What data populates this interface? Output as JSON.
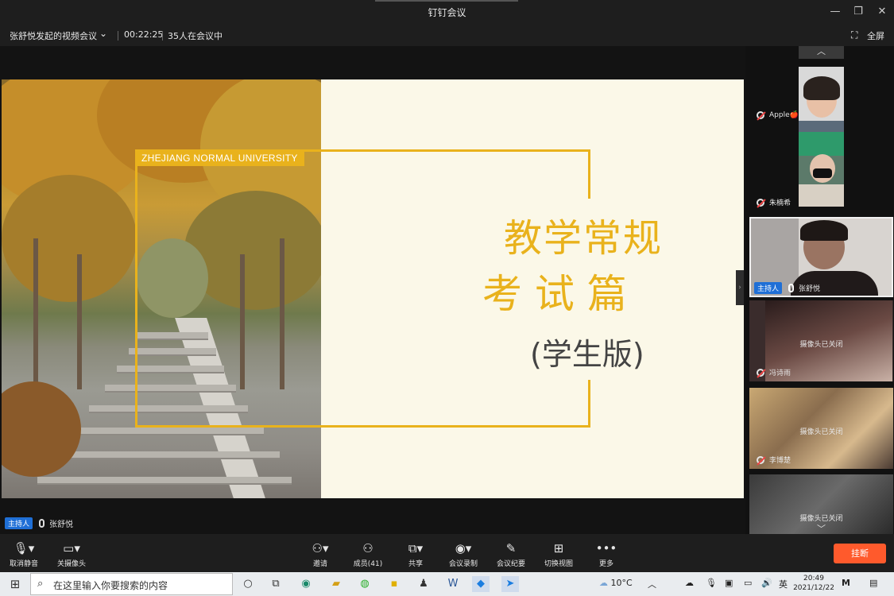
{
  "window": {
    "title": "钉钉会议"
  },
  "meeting": {
    "title": "张舒悦发起的视频会议",
    "duration": "00:22:25",
    "attendees": "35人在会议中",
    "fullscreen_label": "全屏"
  },
  "slide": {
    "university": "ZHEJIANG NORMAL UNIVERSITY",
    "heading_line1": "教学常规",
    "heading_line2": "考 试 篇",
    "heading_line3": "(学生版)"
  },
  "speaker": {
    "role": "主持人",
    "name": "张舒悦"
  },
  "participants": [
    {
      "name": "Apple🍎",
      "muted": true
    },
    {
      "name": "朱楠希",
      "muted": true
    },
    {
      "name": "张舒悦",
      "role": "主持人",
      "active": true
    },
    {
      "name": "冯诗雨",
      "muted": true,
      "camera_status": "摄像头已关闭"
    },
    {
      "name": "李博楚",
      "muted": true,
      "camera_status": "摄像头已关闭"
    },
    {
      "name": "",
      "camera_status": "摄像头已关闭"
    }
  ],
  "toolbar": {
    "mute": "取消静音",
    "camera": "关摄像头",
    "invite": "邀请",
    "members": "成员(41)",
    "share": "共享",
    "record": "会议录制",
    "summary": "会议纪要",
    "view": "切换视图",
    "more": "更多",
    "hangup": "挂断"
  },
  "taskbar": {
    "search_placeholder": "在这里输入你要搜索的内容",
    "temperature": "10°C",
    "ime": "英",
    "time": "20:49",
    "date": "2021/12/22"
  },
  "icons": [
    "windows-start-icon",
    "search-icon",
    "task-view-icon",
    "edge-icon",
    "file-explorer-icon",
    "wechat-icon",
    "sticky-notes-icon",
    "qq-icon",
    "word-icon",
    "dingtalk-icon",
    "feishu-icon",
    "weather-icon",
    "volume-icon",
    "battery-icon",
    "notification-icon"
  ],
  "colors": {
    "accent": "#e9b21c",
    "host_badge": "#1f6fd6",
    "hangup": "#ff5a2c"
  }
}
